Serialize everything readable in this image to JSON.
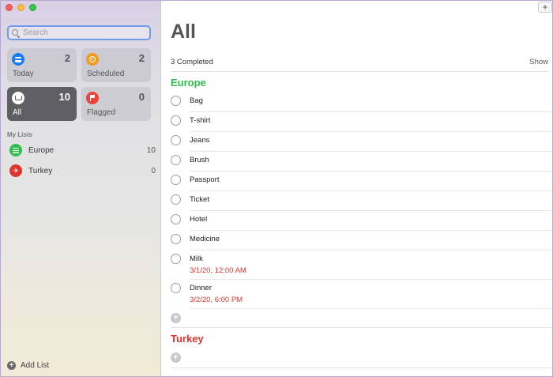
{
  "search": {
    "placeholder": "Search"
  },
  "tiles": [
    {
      "label": "Today",
      "count": "2",
      "color": "#1a7cf5",
      "icon": "calendar-icon"
    },
    {
      "label": "Scheduled",
      "count": "2",
      "color": "#f39a1e",
      "icon": "clock-icon"
    },
    {
      "label": "All",
      "count": "10",
      "color": "#5e5e63",
      "icon": "tray-icon"
    },
    {
      "label": "Flagged",
      "count": "0",
      "color": "#eb4436",
      "icon": "flag-icon"
    }
  ],
  "sidebar": {
    "my_lists_header": "My Lists",
    "lists": [
      {
        "name": "Europe",
        "count": "10",
        "color": "#2fbd4e",
        "icon": "list-bullet-icon"
      },
      {
        "name": "Turkey",
        "count": "0",
        "color": "#e0342e",
        "icon": "airplane-icon"
      }
    ],
    "add_list_label": "Add List"
  },
  "main": {
    "new_button": "+",
    "title": "All",
    "completed_text": "3 Completed",
    "show_label": "Show",
    "groups": [
      {
        "name": "Europe",
        "color": "#2fbd4e",
        "items": [
          {
            "text": "Bag"
          },
          {
            "text": "T-shirt"
          },
          {
            "text": "Jeans"
          },
          {
            "text": "Brush"
          },
          {
            "text": "Passport"
          },
          {
            "text": "Ticket"
          },
          {
            "text": "Hotel"
          },
          {
            "text": "Medicine"
          },
          {
            "text": "Milk",
            "date": "3/1/20, 12:00 AM"
          },
          {
            "text": "Dinner",
            "date": "3/2/20, 6:00 PM"
          }
        ]
      },
      {
        "name": "Turkey",
        "color": "#e0342e",
        "items": []
      }
    ]
  }
}
